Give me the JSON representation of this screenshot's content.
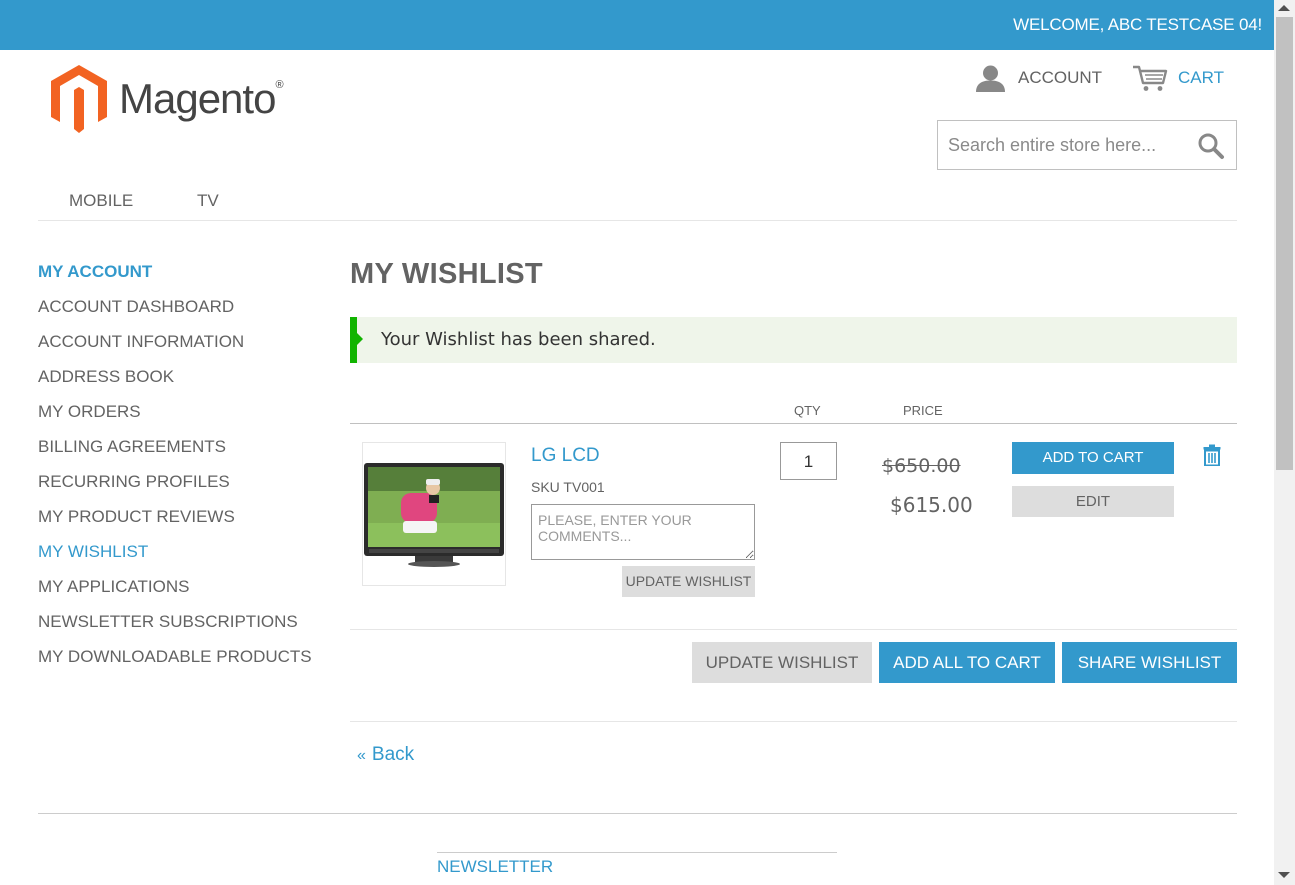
{
  "header": {
    "welcome": "WELCOME, ABC TESTCASE 04!",
    "logo_text": "Magento",
    "logo_mark": "®",
    "account_label": "ACCOUNT",
    "cart_label": "CART",
    "search_placeholder": "Search entire store here..."
  },
  "nav": {
    "items": [
      {
        "label": "MOBILE"
      },
      {
        "label": "TV"
      }
    ]
  },
  "sidebar": {
    "title": "MY ACCOUNT",
    "items": [
      {
        "label": "ACCOUNT DASHBOARD"
      },
      {
        "label": "ACCOUNT INFORMATION"
      },
      {
        "label": "ADDRESS BOOK"
      },
      {
        "label": "MY ORDERS"
      },
      {
        "label": "BILLING AGREEMENTS"
      },
      {
        "label": "RECURRING PROFILES"
      },
      {
        "label": "MY PRODUCT REVIEWS"
      },
      {
        "label": "MY WISHLIST"
      },
      {
        "label": "MY APPLICATIONS"
      },
      {
        "label": "NEWSLETTER SUBSCRIPTIONS"
      },
      {
        "label": "MY DOWNLOADABLE PRODUCTS"
      }
    ]
  },
  "main": {
    "title": "MY WISHLIST",
    "success_message": "Your Wishlist has been shared.",
    "columns": {
      "qty": "QTY",
      "price": "PRICE"
    },
    "item": {
      "name": "LG LCD",
      "sku": "SKU TV001",
      "comment_placeholder": "PLEASE, ENTER YOUR COMMENTS...",
      "update_label": "UPDATE WISHLIST",
      "qty": "1",
      "old_price": "$650.00",
      "price": "$615.00",
      "add_to_cart_label": "ADD TO CART",
      "edit_label": "EDIT"
    },
    "actions": {
      "update_wishlist": "UPDATE WISHLIST",
      "add_all_to_cart": "ADD ALL TO CART",
      "share_wishlist": "SHARE WISHLIST"
    },
    "back_label": "Back",
    "back_prefix": "«"
  },
  "footer": {
    "newsletter_title": "NEWSLETTER"
  },
  "colors": {
    "accent": "#3399cc",
    "success": "#11b400",
    "logo_orange": "#f26322"
  }
}
